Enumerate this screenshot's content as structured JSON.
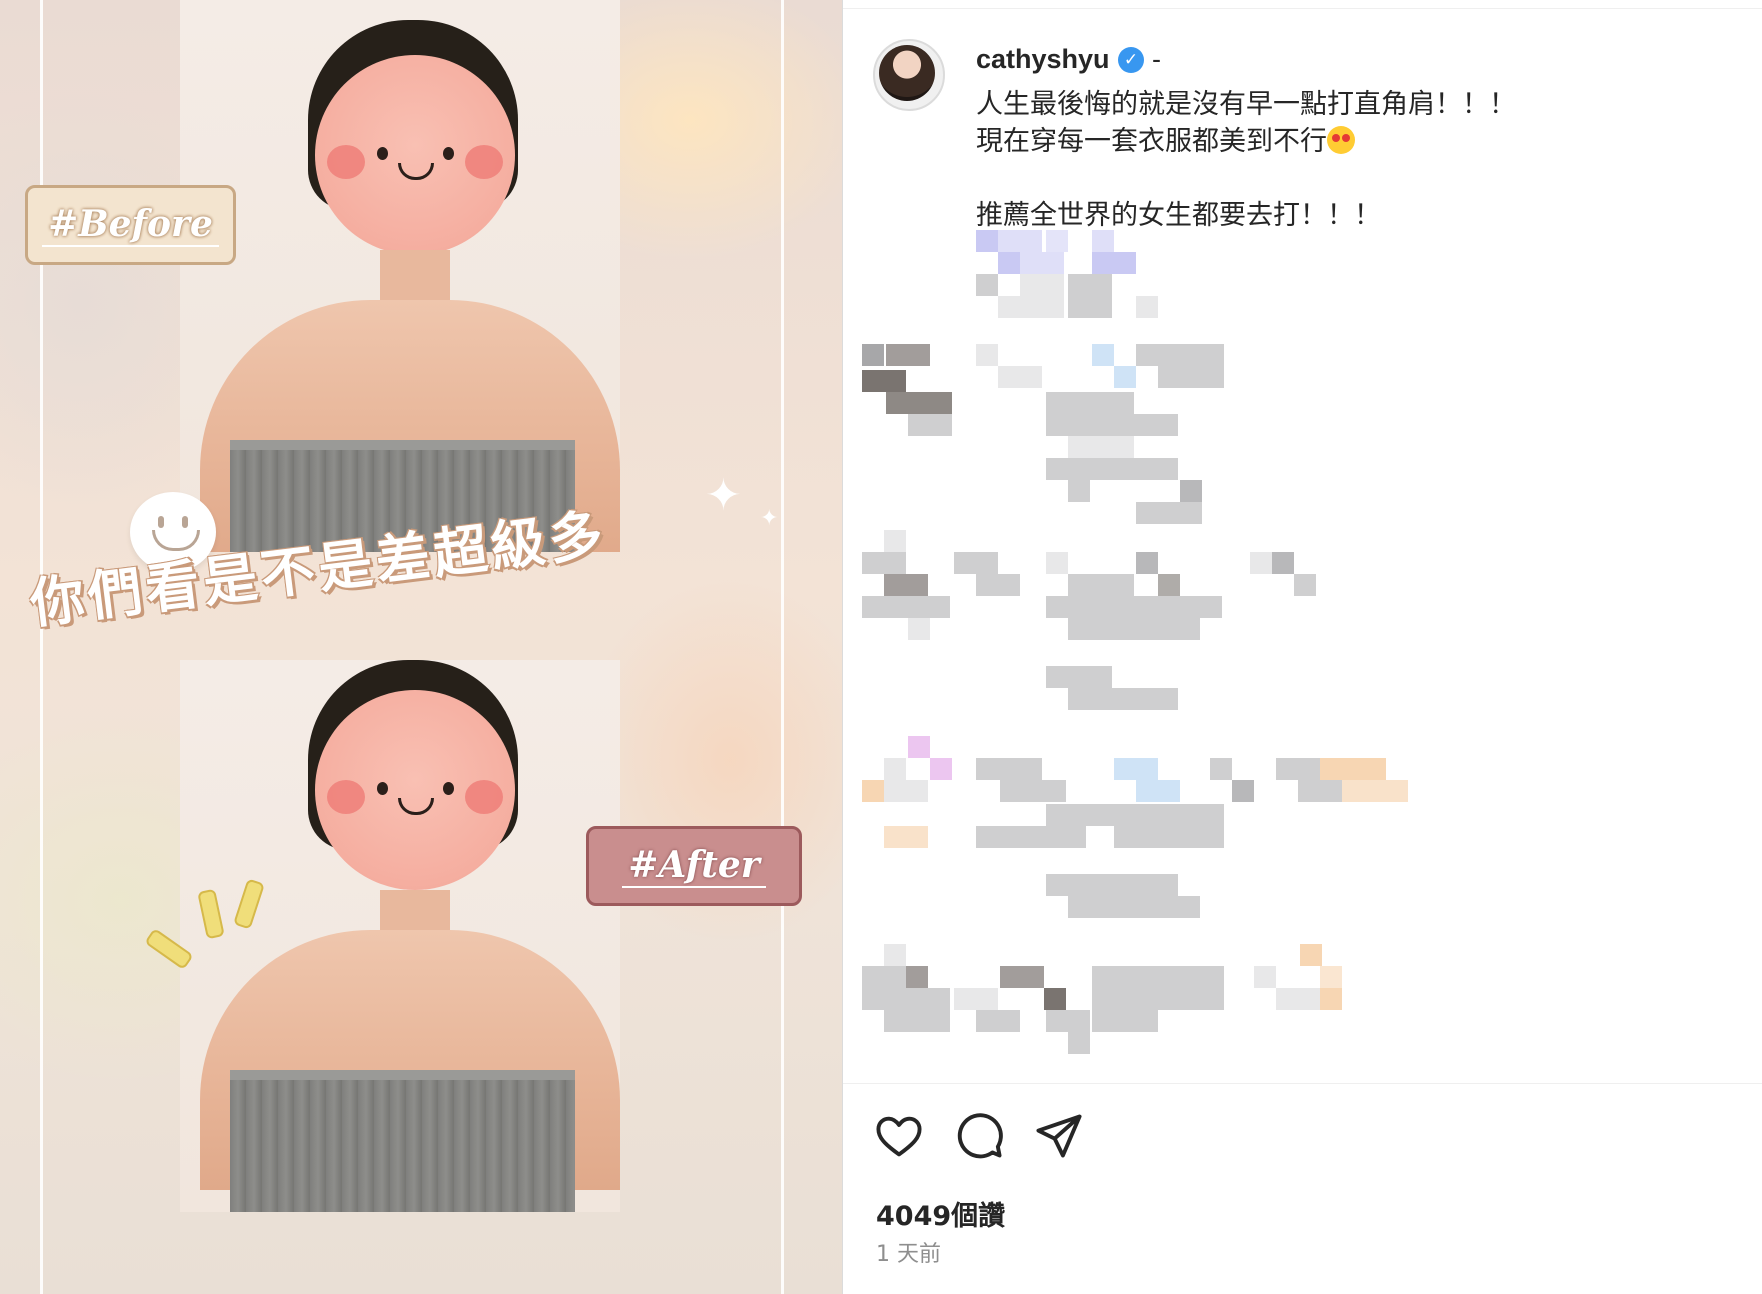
{
  "post": {
    "tag_before": "#Before",
    "tag_after": "#After",
    "headline": "你們看是不是差超級多"
  },
  "caption": {
    "username": "cathyshyu",
    "separator": "-",
    "lines": [
      "人生最後悔的就是沒有早一點打直角肩！！！",
      "現在穿每一套衣服都美到不行",
      "推薦全世界的女生都要去打！！！"
    ],
    "emoji": "heart-eyes-emoji"
  },
  "actions": {
    "like_icon": "heart-icon",
    "comment_icon": "comment-icon",
    "share_icon": "send-icon"
  },
  "stats": {
    "likes": "4049個讚",
    "time": "1 天前"
  },
  "colors": {
    "verified": "#3897f0",
    "text": "#262626",
    "muted": "#8e8e8e"
  }
}
